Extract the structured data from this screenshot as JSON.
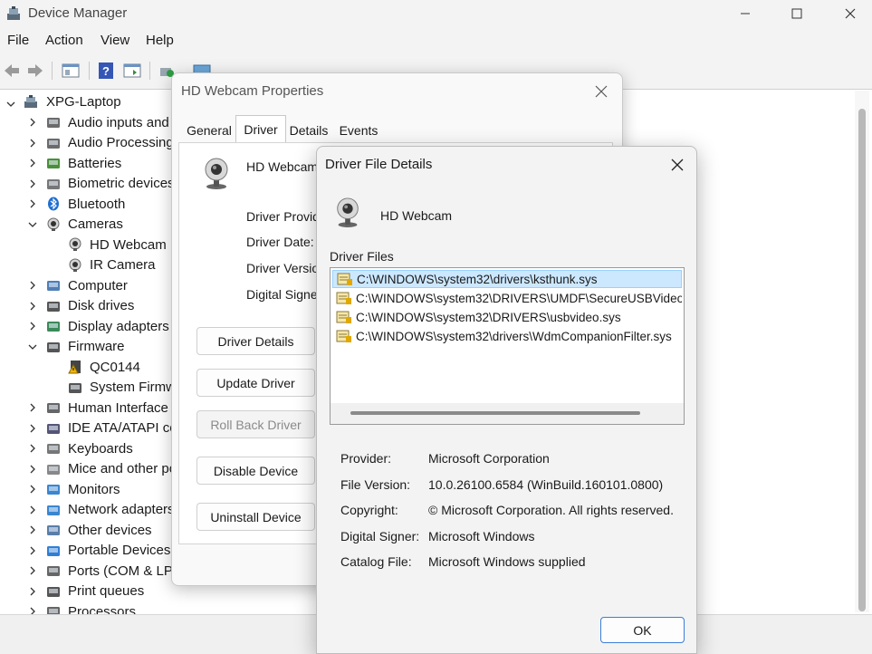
{
  "window": {
    "title": "Device Manager"
  },
  "menu": [
    "File",
    "Action",
    "View",
    "Help"
  ],
  "toolbar": {
    "icons": [
      "back-arrow-icon",
      "forward-arrow-icon",
      "properties-icon",
      "help-icon",
      "action-pane-icon",
      "scan-hardware-icon",
      "monitor-icon"
    ]
  },
  "tree": {
    "root": "XPG-Laptop",
    "items": [
      {
        "label": "Audio inputs and",
        "icon": "audio-icon",
        "expanded": false
      },
      {
        "label": "Audio Processing",
        "icon": "audio-icon",
        "expanded": false
      },
      {
        "label": "Batteries",
        "icon": "battery-icon",
        "expanded": false
      },
      {
        "label": "Biometric devices",
        "icon": "fingerprint-icon",
        "expanded": false
      },
      {
        "label": "Bluetooth",
        "icon": "bluetooth-icon",
        "expanded": false
      },
      {
        "label": "Cameras",
        "icon": "camera-icon",
        "expanded": true
      },
      {
        "label": "HD Webcam",
        "icon": "camera-icon",
        "child": true
      },
      {
        "label": "IR Camera",
        "icon": "camera-icon",
        "child": true
      },
      {
        "label": "Computer",
        "icon": "computer-icon",
        "expanded": false
      },
      {
        "label": "Disk drives",
        "icon": "disk-icon",
        "expanded": false
      },
      {
        "label": "Display adapters",
        "icon": "display-adapter-icon",
        "expanded": false
      },
      {
        "label": "Firmware",
        "icon": "firmware-icon",
        "expanded": true
      },
      {
        "label": "QC0144",
        "icon": "warning-firmware-icon",
        "child": true
      },
      {
        "label": "System Firmw",
        "icon": "firmware-icon",
        "child": true
      },
      {
        "label": "Human Interface I",
        "icon": "hid-icon",
        "expanded": false
      },
      {
        "label": "IDE ATA/ATAPI con",
        "icon": "ide-icon",
        "expanded": false
      },
      {
        "label": "Keyboards",
        "icon": "keyboard-icon",
        "expanded": false
      },
      {
        "label": "Mice and other po",
        "icon": "mouse-icon",
        "expanded": false
      },
      {
        "label": "Monitors",
        "icon": "monitor-icon",
        "expanded": false
      },
      {
        "label": "Network adapters",
        "icon": "network-icon",
        "expanded": false
      },
      {
        "label": "Other devices",
        "icon": "unknown-device-icon",
        "expanded": false
      },
      {
        "label": "Portable Devices",
        "icon": "portable-device-icon",
        "expanded": false
      },
      {
        "label": "Ports (COM & LPT",
        "icon": "port-icon",
        "expanded": false
      },
      {
        "label": "Print queues",
        "icon": "printer-icon",
        "expanded": false
      },
      {
        "label": "Processors",
        "icon": "processor-icon",
        "expanded": false
      }
    ]
  },
  "properties": {
    "title": "HD Webcam Properties",
    "tabs": [
      "General",
      "Driver",
      "Details",
      "Events"
    ],
    "active_tab": "Driver",
    "device_name": "HD Webcam",
    "labels": [
      "Driver Provide",
      "Driver Date:",
      "Driver Version",
      "Digital Signer"
    ],
    "buttons": [
      "Driver Details",
      "Update Driver",
      "Roll Back Driver",
      "Disable Device",
      "Uninstall Device"
    ]
  },
  "driver_file_details": {
    "title": "Driver File Details",
    "device_name": "HD Webcam",
    "files_label": "Driver Files",
    "files": [
      "C:\\WINDOWS\\system32\\drivers\\ksthunk.sys",
      "C:\\WINDOWS\\system32\\DRIVERS\\UMDF\\SecureUSBVideo.",
      "C:\\WINDOWS\\system32\\DRIVERS\\usbvideo.sys",
      "C:\\WINDOWS\\system32\\drivers\\WdmCompanionFilter.sys"
    ],
    "selected_index": 0,
    "info": [
      {
        "label": "Provider:",
        "value": "Microsoft Corporation"
      },
      {
        "label": "File Version:",
        "value": "10.0.26100.6584 (WinBuild.160101.0800)"
      },
      {
        "label": "Copyright:",
        "value": "© Microsoft Corporation. All rights reserved."
      },
      {
        "label": "Digital Signer:",
        "value": "Microsoft Windows"
      },
      {
        "label": "Catalog File:",
        "value": "Microsoft Windows supplied"
      }
    ],
    "ok_label": "OK"
  },
  "colors": {
    "selection": "#cce8ff",
    "accent": "#0067c0",
    "warning": "#f2b600"
  }
}
